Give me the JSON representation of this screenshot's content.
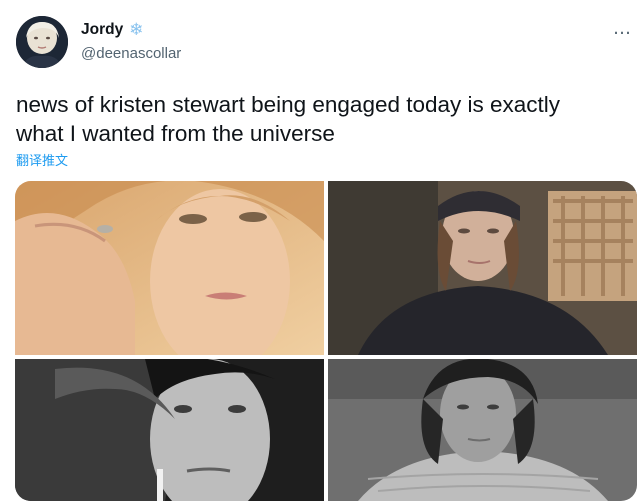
{
  "tweet": {
    "author": {
      "display_name": "Jordy",
      "badge_emoji": "❄",
      "handle": "@deenascollar",
      "avatar_icon": "profile-photo"
    },
    "more_icon": "…",
    "text": "news of kristen stewart being engaged today is exactly\nwhat I wanted from the universe",
    "translate_label": "翻译推文",
    "media": [
      {
        "name": "photo-1",
        "style": "color portrait, blonde hair, hand near face"
      },
      {
        "name": "photo-2",
        "style": "color portrait, beanie, dark sweatshirt, outdoor"
      },
      {
        "name": "photo-3",
        "style": "black and white portrait, cigarette"
      },
      {
        "name": "photo-4",
        "style": "black and white portrait, knit sweater"
      }
    ]
  },
  "colors": {
    "text": "#0f1419",
    "secondary": "#536471",
    "link": "#1d9bf0",
    "badge": "#88c2ee"
  }
}
